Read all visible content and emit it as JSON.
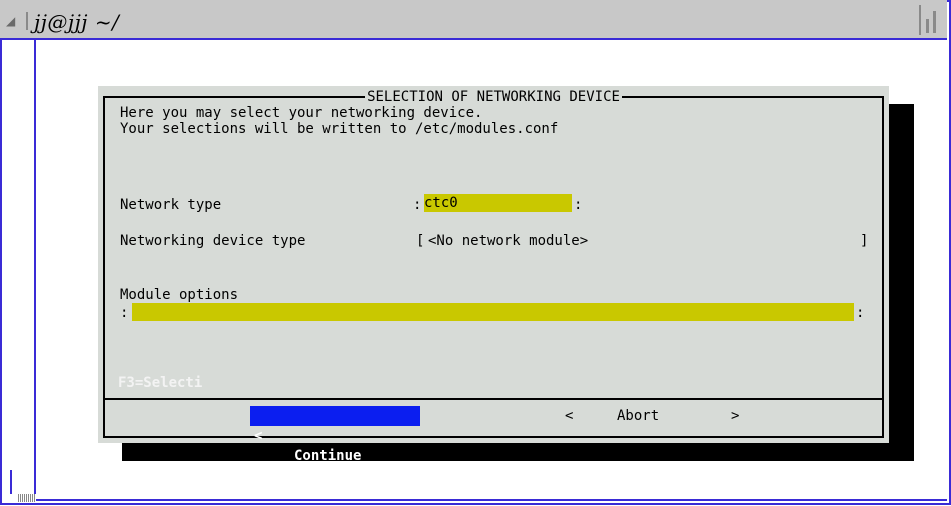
{
  "window": {
    "title": "jj@jjj ~/"
  },
  "dialog": {
    "title": "SELECTION OF NETWORKING DEVICE",
    "intro_line1": "Here you may select your networking device.",
    "intro_line2": "Your selections will be written to /etc/modules.conf",
    "network_type": {
      "label": "Network type",
      "value": "ctc0"
    },
    "device_type": {
      "label": "Networking device type",
      "value": "<No network module>"
    },
    "module_options": {
      "label": "Module options",
      "value": ""
    },
    "fkey_hint": "F3=Selecti",
    "buttons": {
      "continue": "Continue",
      "abort": "Abort"
    }
  },
  "colors": {
    "field_bg": "#c9c800",
    "dialog_bg": "#d7dbd7",
    "button_active": "#0b1ef0",
    "window_border": "#3a2bd6"
  }
}
